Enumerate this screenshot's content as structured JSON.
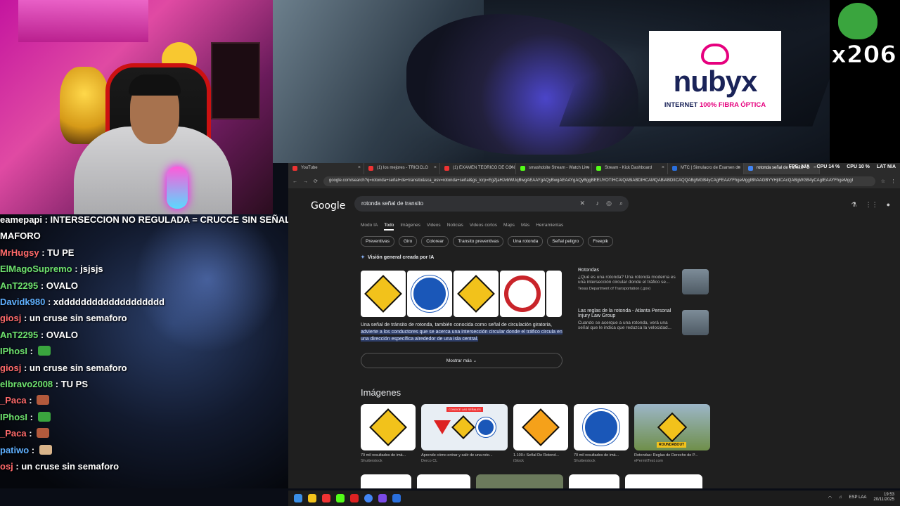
{
  "banner": {
    "brand": "nubyx",
    "tagline_prefix": "INTERNET ",
    "tagline_highlight": "100% FIBRA ÓPTICA"
  },
  "emote": {
    "count": "x206"
  },
  "chat": [
    {
      "user": "eamepapi",
      "text": " : INTERSECCION NO REGULADA = CRUCCE SIN SEÑALIZACI",
      "color": "#ffffff"
    },
    {
      "user": "",
      "text": "MAFORO",
      "color": "#ffffff"
    },
    {
      "user": "MrHugsy",
      "text": " : TU PE",
      "color": "#ff6a6a"
    },
    {
      "user": "ElMagoSupremo",
      "text": " : jsjsjs",
      "color": "#6ee26e"
    },
    {
      "user": "AnT2295",
      "text": " : OVALO",
      "color": "#6ee26e"
    },
    {
      "user": "Davidk980",
      "text": " : xddddddddddddddddddd",
      "color": "#5fb0ff"
    },
    {
      "user": "giosj",
      "text": " : un cruse sin semaforo",
      "color": "#ff6a6a"
    },
    {
      "user": "AnT2295",
      "text": " : OVALO",
      "color": "#6ee26e"
    },
    {
      "user": "IPhosI",
      "text": " : ",
      "color": "#6ee26e",
      "emote": "frog"
    },
    {
      "user": "giosj",
      "text": " : un cruse sin semaforo",
      "color": "#ff6a6a"
    },
    {
      "user": "elbravo2008",
      "text": " : TU PS",
      "color": "#6ee26e"
    },
    {
      "user": "_Paca",
      "text": " : ",
      "color": "#ff6a6a",
      "emote": "face"
    },
    {
      "user": "IPhosI",
      "text": " : ",
      "color": "#6ee26e",
      "emote": "frog"
    },
    {
      "user": "_Paca",
      "text": " : ",
      "color": "#ff6a6a",
      "emote": "face"
    },
    {
      "user": "patiwo",
      "text": " : ",
      "color": "#5fb0ff",
      "emote": "hand"
    },
    {
      "user": "osj",
      "text": " : un cruse sin semaforo",
      "color": "#ff6a6a"
    }
  ],
  "browser": {
    "tabs": [
      {
        "label": "YouTube",
        "fav": "#e33"
      },
      {
        "label": "(1) los mejores - TRICICLO",
        "fav": "#e33"
      },
      {
        "label": "(1) EXAMEN TEORICO DE CON",
        "fav": "#e33"
      },
      {
        "label": "smashdoite Stream - Watch Live",
        "fav": "#53fc18"
      },
      {
        "label": "Stream - Kick Dashboard",
        "fav": "#53fc18"
      },
      {
        "label": "MTC | Simulacro de Examen de",
        "fav": "#2a6fdc"
      },
      {
        "label": "rotonda señal de transito - B",
        "fav": "#4285f4",
        "active": true
      }
    ],
    "stats": [
      "FPS: N/A",
      "CPU 14 %",
      "CPU 10 %",
      "LAT N/A"
    ],
    "url": "google.com/search?q=rotonda+señal+de+transito&sca_esv=rotonda+señal&gs_lcrp=EgZjaHJvbWUqBwgAEAAYgAQyBwgAEAAYgAQyBggBEEUYOTIHCAIQABiABDIHCAMQABiABDIICAQQABgWGB4yCAgFEAAYFhgeMggIBhAAGBYYHjIICAcQABgWGB4yCAgIEAAYFhgeMggI",
    "search": {
      "query": "rotonda señal de transito"
    },
    "filters": [
      "Modo IA",
      "Todo",
      "Imágenes",
      "Videos",
      "Noticias",
      "Videos cortos",
      "Maps",
      "Más",
      "Herramientas"
    ],
    "chips": [
      "Preventivas",
      "Giro",
      "Colorear",
      "Transito preventivas",
      "Una rotonda",
      "Señal peligro",
      "Freepik"
    ],
    "ai": {
      "title": "Visión general creada por IA",
      "text_plain": "Una señal de tránsito de rotonda, también conocida como señal de circulación giratoria, ",
      "text_highlight": "advierte a los conductores que se acerca una intersección circular donde el tráfico circula en una dirección específica alrededor de una isla central.",
      "more": "Mostrar más"
    },
    "side": [
      {
        "title": "Rotondas",
        "desc": "¿Qué es una rotonda? Una rotonda moderna es una intersección circular donde el tráfico se...",
        "src": "Texas Department of Transportation (.gov)"
      },
      {
        "title": "Las reglas de la rotonda - Atlanta Personal Injury Law Group",
        "desc": "Cuando se acerque a una rotonda, verá una señal que le indica que reduzca la velocidad...",
        "src": ""
      }
    ],
    "images_heading": "Imágenes",
    "images": [
      {
        "cap": "70 mil resultados de imá...",
        "src": "Shutterstock"
      },
      {
        "cap": "Aprende cómo entrar y salir de una roto...",
        "src": "Derco CL"
      },
      {
        "cap": "1.100+ Señal De Rotond...",
        "src": "iStock"
      },
      {
        "cap": "70 mil resultados de imá...",
        "src": "Shutterstock"
      },
      {
        "cap": "Rotondas: Reglas de Derecho de P...",
        "src": "ePermitTest.com"
      }
    ],
    "image_overlay": "CONOCE LAS SEÑALES",
    "roundabout_sign": "ROUNDABOUT"
  },
  "taskbar": {
    "lang": "ESP LAA",
    "time": "19:53",
    "date": "20/11/2025"
  }
}
